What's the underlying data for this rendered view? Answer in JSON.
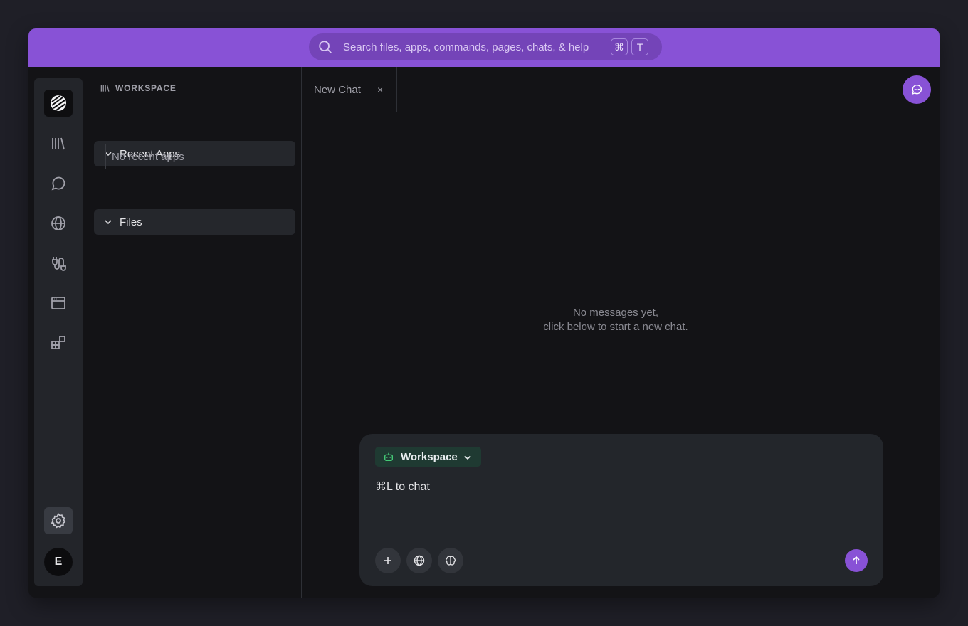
{
  "search": {
    "placeholder": "Search files, apps, commands, pages, chats, & help",
    "shortcut_keys": [
      "⌘",
      "T"
    ],
    "icon": "search-icon"
  },
  "rail": {
    "items": [
      {
        "name": "app-logo",
        "icon": "striped-logo-icon"
      },
      {
        "name": "library",
        "icon": "library-icon"
      },
      {
        "name": "chats",
        "icon": "chat-bubble-icon"
      },
      {
        "name": "web",
        "icon": "globe-icon"
      },
      {
        "name": "integrations",
        "icon": "plug-icon"
      },
      {
        "name": "browser",
        "icon": "browser-window-icon"
      },
      {
        "name": "apps",
        "icon": "apps-grid-icon"
      }
    ],
    "settings_icon": "gear-icon",
    "avatar_initial": "E"
  },
  "sidebar": {
    "header": "WORKSPACE",
    "sections": [
      {
        "label": "Recent Apps",
        "empty_text": "No recent apps"
      },
      {
        "label": "Files"
      }
    ]
  },
  "tabs": [
    {
      "label": "New Chat",
      "close": "×"
    }
  ],
  "main": {
    "empty_line1": "No messages yet,",
    "empty_line2": "click below to start a new chat."
  },
  "composer": {
    "agent_label": "Workspace",
    "input_text": "⌘L to chat",
    "tool_icons": [
      "plus-icon",
      "globe-icon",
      "brain-icon"
    ],
    "send_icon": "arrow-up-icon"
  },
  "colors": {
    "accent": "#8852d6",
    "background": "#131316",
    "panel": "#23262b",
    "agent_chip": "#1f3a32"
  }
}
